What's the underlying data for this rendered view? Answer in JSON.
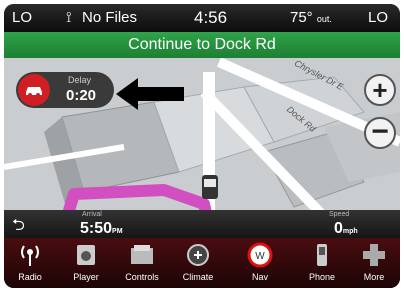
{
  "status": {
    "left_label": "LO",
    "usb_icon": "usb-icon",
    "media": "No Files",
    "time": "4:56",
    "temp": "75°",
    "temp_unit": "out.",
    "right_label": "LO"
  },
  "map": {
    "banner": "Continue to Dock Rd",
    "delay_label": "Delay",
    "delay_value": "0:20",
    "road_labels": [
      "Chrysler Dr E",
      "Dock Rd"
    ],
    "zoom_in": "+",
    "zoom_out": "−"
  },
  "infobar": {
    "back_icon": "back-arrow-icon",
    "arrival_label": "Arrival",
    "arrival_value": "5:50",
    "arrival_suffix": "PM",
    "speed_label": "Speed",
    "speed_value": "0",
    "speed_unit": "mph"
  },
  "dock": [
    {
      "label": "Radio",
      "icon": "radio-icon"
    },
    {
      "label": "Player",
      "icon": "player-icon"
    },
    {
      "label": "Controls",
      "icon": "controls-icon"
    },
    {
      "label": "Climate",
      "icon": "climate-icon"
    },
    {
      "label": "Nav",
      "icon": "nav-icon"
    },
    {
      "label": "Phone",
      "icon": "phone-icon"
    },
    {
      "label": "More",
      "icon": "more-icon"
    }
  ],
  "colors": {
    "banner_green": "#2a9a44",
    "dock_red": "#4a0d10",
    "delay_red": "#cf1f25",
    "route_magenta": "#d24fc2"
  }
}
